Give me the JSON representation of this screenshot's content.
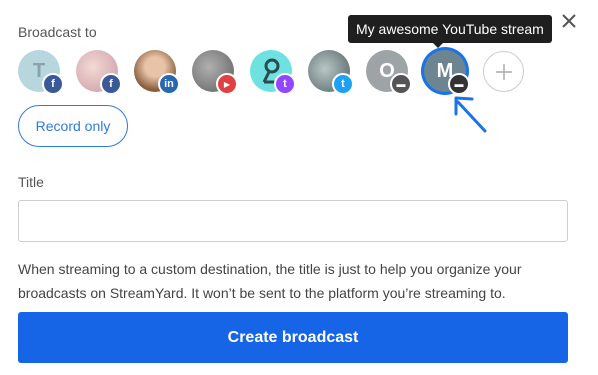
{
  "broadcast_label": "Broadcast to",
  "tooltip_text": "My awesome YouTube stream",
  "destinations": [
    {
      "name": "facebook",
      "initial": "T",
      "avatar_color": "#b8d6dd",
      "badge_color": "#3b5998",
      "badge_icon": "facebook-icon",
      "badge_glyph": "f"
    },
    {
      "name": "facebook-group",
      "initial": "",
      "avatar_color": "#e9c7c2",
      "badge_color": "#3b5998",
      "badge_icon": "facebook-icon",
      "badge_glyph": "f"
    },
    {
      "name": "linkedin",
      "initial": "",
      "avatar_color": "#a07a5e",
      "badge_color": "#2867b2",
      "badge_icon": "linkedin-icon",
      "badge_glyph": "in"
    },
    {
      "name": "youtube",
      "initial": "",
      "avatar_color": "#8a8a8a",
      "badge_color": "#e04040",
      "badge_icon": "youtube-icon",
      "badge_glyph": "▶"
    },
    {
      "name": "twitch",
      "initial": "",
      "avatar_color": "#6de2e0",
      "badge_color": "#9146ff",
      "badge_icon": "twitch-icon",
      "badge_glyph": "t"
    },
    {
      "name": "twitter",
      "initial": "",
      "avatar_color": "#7f8e8f",
      "badge_color": "#1da1f2",
      "badge_icon": "twitter-icon",
      "badge_glyph": "t"
    },
    {
      "name": "custom-rtmp-o",
      "initial": "O",
      "avatar_color": "#9ea3a6",
      "badge_color": "#555",
      "badge_icon": "server-icon",
      "badge_glyph": "▬"
    },
    {
      "name": "custom-rtmp-m",
      "initial": "M",
      "avatar_color": "#6c8590",
      "badge_color": "#333",
      "badge_icon": "server-icon",
      "badge_glyph": "▬"
    }
  ],
  "record_only_label": "Record only",
  "title_label": "Title",
  "title_input": {
    "value": "",
    "placeholder": ""
  },
  "help_text": "When streaming to a custom destination, the title is just to help you organize your broadcasts on StreamYard. It won’t be sent to the platform you’re streaming to.",
  "create_button_label": "Create broadcast",
  "colors": {
    "accent": "#1565e6",
    "selected_ring": "#1a73e8",
    "arrow": "#1a73e8"
  }
}
